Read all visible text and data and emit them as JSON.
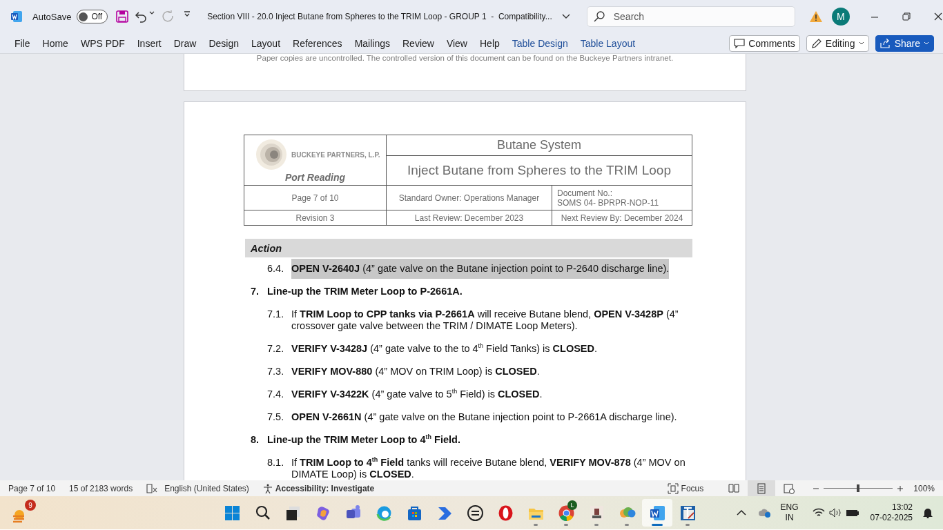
{
  "title_bar": {
    "autosave_label": "AutoSave",
    "autosave": {
      "label": "Off",
      "on": false
    },
    "title": "Section VIII - 20.0 Inject Butane from Spheres to the TRIM Loop - GROUP 1  -  Compatibility...",
    "search": {
      "placeholder": "Search"
    },
    "avatar": "M"
  },
  "ribbon": {
    "tabs": [
      {
        "label": "File",
        "kind": "normal",
        "selected": false
      },
      {
        "label": "Home",
        "kind": "normal",
        "selected": false
      },
      {
        "label": "WPS PDF",
        "kind": "normal",
        "selected": false
      },
      {
        "label": "Insert",
        "kind": "normal",
        "selected": false
      },
      {
        "label": "Draw",
        "kind": "normal",
        "selected": false
      },
      {
        "label": "Design",
        "kind": "normal",
        "selected": false
      },
      {
        "label": "Layout",
        "kind": "normal",
        "selected": false
      },
      {
        "label": "References",
        "kind": "normal",
        "selected": false
      },
      {
        "label": "Mailings",
        "kind": "normal",
        "selected": false
      },
      {
        "label": "Review",
        "kind": "normal",
        "selected": false
      },
      {
        "label": "View",
        "kind": "normal",
        "selected": false
      },
      {
        "label": "Help",
        "kind": "normal",
        "selected": false
      },
      {
        "label": "Table Design",
        "kind": "contextual",
        "selected": false
      },
      {
        "label": "Table Layout",
        "kind": "contextual",
        "selected": false
      }
    ],
    "buttons": {
      "comments": "Comments",
      "editing": "Editing",
      "share": "Share"
    }
  },
  "document": {
    "previous_page_footer": "Paper copies are uncontrolled. The controlled version of this document can be found on the Buckeye Partners intranet.",
    "header": {
      "company": "BUCKEYE PARTNERS, L.P.",
      "site": "Port Reading",
      "system": "Butane System",
      "procedure": "Inject Butane from Spheres to the TRIM Loop",
      "page": "Page 7 of 10",
      "owner": "Standard Owner: Operations Manager",
      "document_no_label": "Document No.:",
      "document_no": "SOMS 04- BPRPR-NOP-11",
      "revision": "Revision 3",
      "last_review": "Last Review: December 2023",
      "next_review": "Next Review By: December 2024"
    },
    "action_heading": "Action",
    "steps": [
      {
        "kind": "substep",
        "number": "6.4.",
        "text": "**OPEN V-2640J** (4” gate valve on the Butane injection point to P-2640 discharge line).",
        "highlighted": true
      },
      {
        "kind": "step",
        "number": "7.",
        "text": "Line-up the TRIM Meter Loop to P-2661A.",
        "highlighted": false
      },
      {
        "kind": "substep",
        "number": "7.1.",
        "text": "If **TRIM Loop to CPP tanks via P-2661A** will receive Butane blend, **OPEN V-3428P** (4” crossover gate valve between the TRIM / DIMATE Loop Meters).",
        "highlighted": false
      },
      {
        "kind": "substep",
        "number": "7.2.",
        "text": "**VERIFY V-3428J** (4” gate valve to the to 4$^{th}$ Field Tanks) is **CLOSED**.",
        "highlighted": false
      },
      {
        "kind": "substep",
        "number": "7.3.",
        "text": "**VERIFY MOV-880** (4” MOV on TRIM Loop) is **CLOSED**.",
        "highlighted": false
      },
      {
        "kind": "substep",
        "number": "7.4.",
        "text": "**VERIFY V-3422K** (4” gate valve to 5$^{th}$ Field) is **CLOSED**.",
        "highlighted": false
      },
      {
        "kind": "substep",
        "number": "7.5.",
        "text": "**OPEN V-2661N** (4” gate valve on the Butane injection point to P-2661A discharge line).",
        "highlighted": false
      },
      {
        "kind": "step",
        "number": "8.",
        "text": "Line-up the TRIM Meter Loop to 4$^{th}$ Field.",
        "highlighted": false
      },
      {
        "kind": "substep",
        "number": "8.1.",
        "text": "If **TRIM Loop to 4$^{th}$ Field** tanks will receive Butane blend, **VERIFY MOV-878** (4” MOV on DIMATE Loop) is **CLOSED**.",
        "highlighted": false
      }
    ]
  },
  "status_bar": {
    "page": "Page 7 of 10",
    "words": "15 of 2183 words",
    "language": "English (United States)",
    "accessibility": "Accessibility: Investigate",
    "focus": "Focus",
    "views": [
      {
        "kind": "read",
        "selected": false
      },
      {
        "kind": "print",
        "selected": true
      },
      {
        "kind": "web",
        "selected": false
      }
    ],
    "zoom": {
      "level": 0.5
    },
    "zoom_percent": "100%"
  },
  "taskbar": {
    "weather_badge": "9",
    "apps": [
      {
        "kind": "start",
        "running": false,
        "selected": false
      },
      {
        "kind": "search",
        "running": false,
        "selected": false
      },
      {
        "kind": "taskview",
        "running": false,
        "selected": false
      },
      {
        "kind": "copilot",
        "running": false,
        "selected": false
      },
      {
        "kind": "teams",
        "running": false,
        "selected": false
      },
      {
        "kind": "edge",
        "running": false,
        "selected": false
      },
      {
        "kind": "store",
        "running": false,
        "selected": false
      },
      {
        "kind": "automate",
        "running": false,
        "selected": false
      },
      {
        "kind": "dell",
        "running": false,
        "selected": false
      },
      {
        "kind": "opera",
        "running": false,
        "selected": false
      },
      {
        "kind": "explorer",
        "running": true,
        "selected": false
      },
      {
        "kind": "chrome",
        "running": true,
        "selected": false,
        "badge": "L"
      },
      {
        "kind": "viewer",
        "running": true,
        "selected": false
      },
      {
        "kind": "cloud",
        "running": true,
        "selected": false
      },
      {
        "kind": "word",
        "running": true,
        "selected": true
      },
      {
        "kind": "editor",
        "running": true,
        "selected": false
      }
    ],
    "language": "ENG",
    "region": "IN",
    "time": "13:02",
    "date": "07-02-2025"
  }
}
